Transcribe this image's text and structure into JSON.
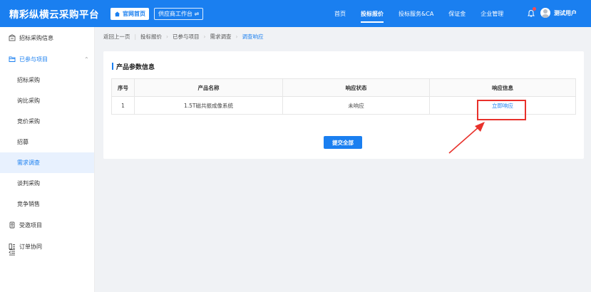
{
  "header": {
    "brand": "精彩纵横云采购平台",
    "home_button": "官网首页",
    "workbench_button": "供应商工作台 ⇌",
    "nav": [
      "首页",
      "投标报价",
      "投标服务&CA",
      "保证金",
      "企业管理"
    ],
    "active_nav": "投标报价",
    "username": "测试用户",
    "accent_color": "#1a7ff0"
  },
  "sidebar": {
    "groups": [
      {
        "label": "招标采购信息",
        "icon": "building-icon"
      },
      {
        "label": "已参与项目",
        "icon": "folder-icon",
        "expanded": true
      },
      {
        "label": "受邀项目",
        "icon": "invite-icon"
      },
      {
        "label": "订单协同",
        "icon": "order-icon"
      }
    ],
    "sub_items": [
      "招标采购",
      "询比采购",
      "竞价采购",
      "招募",
      "需求调查",
      "谈判采购",
      "竞争销售"
    ],
    "active_sub": "需求调查"
  },
  "breadcrumb": {
    "back": "返回上一页",
    "items": [
      "投标报价",
      "已参与项目",
      "需求调查"
    ],
    "current": "调查响应"
  },
  "main": {
    "section_title": "产品参数信息",
    "table": {
      "headers": [
        "序号",
        "产品名称",
        "响应状态",
        "响应信息"
      ],
      "rows": [
        {
          "index": "1",
          "name": "1.5T磁共振成像系统",
          "status": "未响应",
          "action": "立即响应"
        }
      ]
    },
    "submit_label": "提交全部"
  }
}
